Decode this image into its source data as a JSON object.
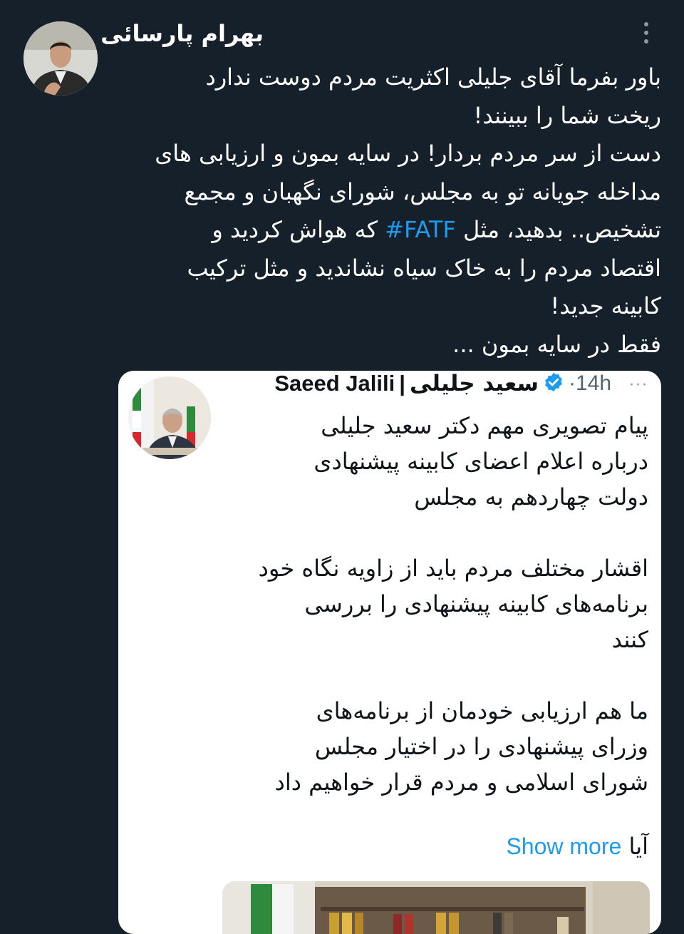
{
  "tweet": {
    "author_name": "بهرام پارسائی",
    "lines": [
      "باور بفرما آقای جلیلی اکثریت مردم دوست ندارد",
      "ریخت شما را ببینند!",
      "دست از سر مردم بردار! در سایه بمون و ارزیابی های",
      "مداخله جویانه تو به مجلس، شورای نگهبان و مجمع"
    ],
    "line5_before": "تشخیص.. بدهید، مثل ",
    "hashtag": "#FATF",
    "line5_after": " که هواش کردید و",
    "lines_end": [
      "اقتصاد مردم را به خاک سیاه نشاندید و مثل ترکیب",
      "کابینه جدید!",
      "فقط در سایه بمون ..."
    ]
  },
  "quote": {
    "name_en": "Saeed Jalili",
    "separator": "|",
    "name_fa": "سعید جلیلی",
    "time": "·14h",
    "more": "···",
    "para1": [
      "پیام تصویری مهم دکتر سعید جلیلی",
      "درباره اعلام اعضای کابینه پیشنهادی",
      "دولت چهاردهم به مجلس"
    ],
    "para2": [
      "اقشار مختلف مردم باید از زاویه نگاه خود",
      "برنامه‌های کابینه پیشنهادی را بررسی",
      "کنند"
    ],
    "para3": [
      "ما هم ارزیابی خودمان از برنامه‌های",
      "وزرای پیشنهادی را در اختیار مجلس",
      "شورای اسلامی و مردم قرار خواهیم داد"
    ],
    "last_word": "آیا",
    "show_more": "Show more"
  },
  "colors": {
    "background": "#15202b",
    "accent": "#1d9bf0",
    "verified": "#1d9bf0"
  }
}
